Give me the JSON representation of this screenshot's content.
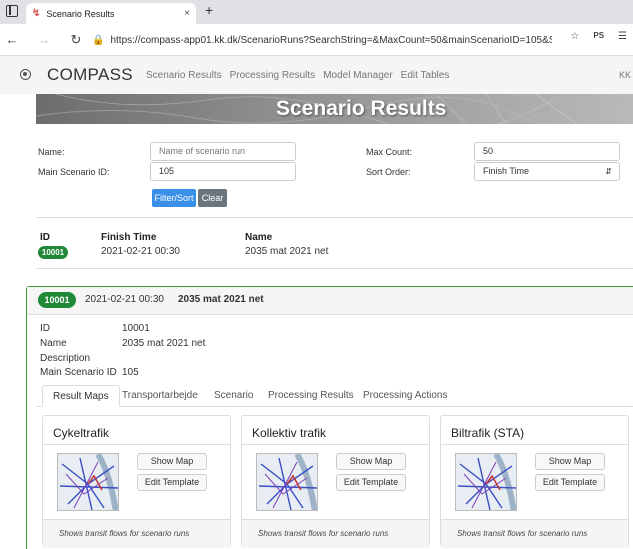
{
  "browser": {
    "tab_title": "Scenario Results",
    "tab_close": "×",
    "new_tab": "+",
    "url": "https://compass-app01.kk.dk/ScenarioRuns?SearchString=&MaxCount=50&mainScenarioID=105&So...",
    "ext_label": "PS"
  },
  "navbar": {
    "brand": "COMPASS",
    "links": [
      "Scenario Results",
      "Processing Results",
      "Model Manager",
      "Edit Tables"
    ],
    "user": "KK"
  },
  "banner": {
    "title": "Scenario Results"
  },
  "filter": {
    "name_label": "Name:",
    "name_placeholder": "Name of scenario run",
    "main_scenario_label": "Main Scenario ID:",
    "main_scenario_value": "105",
    "max_count_label": "Max Count:",
    "max_count_value": "50",
    "sort_order_label": "Sort Order:",
    "sort_order_value": "Finish Time",
    "filter_button": "Filter/Sort",
    "clear_button": "Clear"
  },
  "results_table": {
    "headers": [
      "ID",
      "Finish Time",
      "Name"
    ],
    "rows": [
      {
        "id": "10001",
        "finish_time": "2021-02-21 00:30",
        "name": "2035 mat 2021 net"
      }
    ]
  },
  "detail": {
    "id": "10001",
    "finish_time": "2021-02-21 00:30",
    "name": "2035 mat 2021 net",
    "labels": {
      "id": "ID",
      "name": "Name",
      "description": "Description",
      "main_scenario_id": "Main Scenario ID"
    },
    "values": {
      "id": "10001",
      "name": "2035 mat 2021 net",
      "description": "",
      "main_scenario_id": "105"
    },
    "tabs": [
      "Result Maps",
      "Transportarbejde",
      "Scenario",
      "Processing Results",
      "Processing Actions"
    ],
    "active_tab": "Result Maps",
    "maps": [
      {
        "title": "Cykeltrafik",
        "show": "Show Map",
        "edit": "Edit Template",
        "footer": "Shows transit flows for scenario runs"
      },
      {
        "title": "Kollektiv trafik",
        "show": "Show Map",
        "edit": "Edit Template",
        "footer": "Shows transit flows for scenario runs"
      },
      {
        "title": "Biltrafik (STA)",
        "show": "Show Map",
        "edit": "Edit Template",
        "footer": "Shows transit flows for scenario runs"
      }
    ]
  },
  "colors": {
    "accent": "#3a8fe8",
    "badge": "#218838",
    "card_border": "#3a9a3a"
  }
}
